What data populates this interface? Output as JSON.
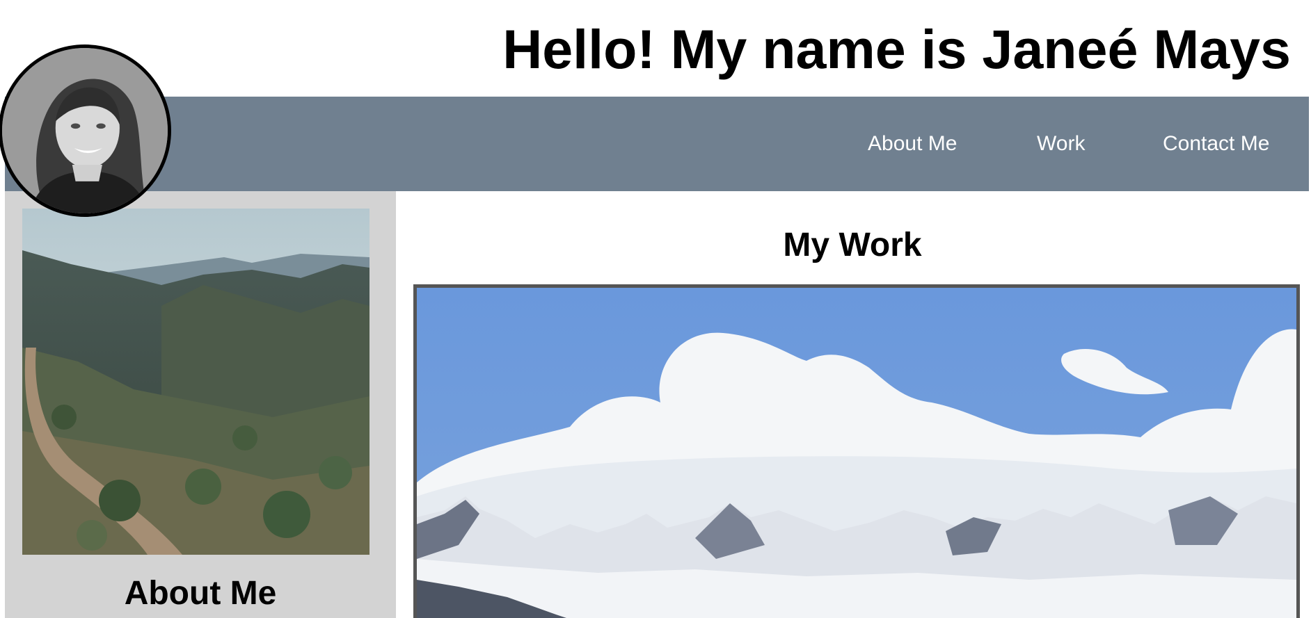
{
  "header": {
    "title": "Hello! My name is Janeé Mays"
  },
  "nav": {
    "items": [
      {
        "label": "About Me"
      },
      {
        "label": "Work"
      },
      {
        "label": "Contact Me"
      }
    ],
    "background_color": "#708090",
    "text_color": "#ffffff"
  },
  "sidebar": {
    "heading": "About Me",
    "background_color": "#d3d3d3"
  },
  "main": {
    "heading": "My Work"
  },
  "icons": {
    "avatar": "profile-photo-icon",
    "sidebar_photo": "mountain-trail-photo",
    "work_photo": "snowy-mountains-photo"
  }
}
